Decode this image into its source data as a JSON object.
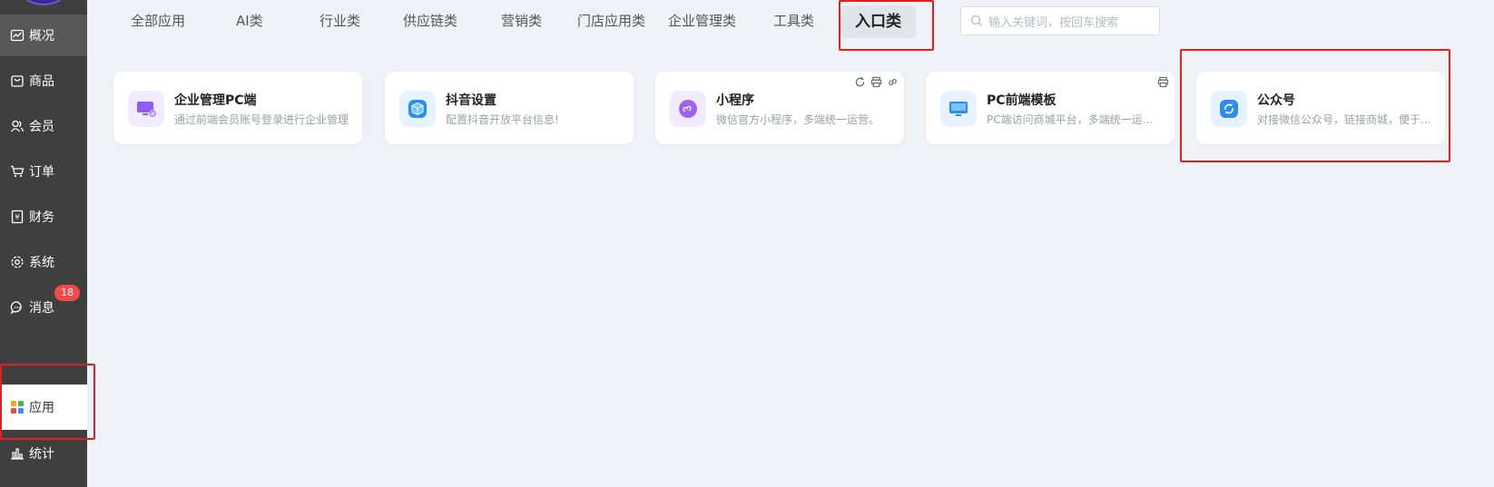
{
  "sidebar": {
    "items": [
      {
        "label": "概况",
        "icon": "chart-line-icon"
      },
      {
        "label": "商品",
        "icon": "shop-icon"
      },
      {
        "label": "会员",
        "icon": "users-icon"
      },
      {
        "label": "订单",
        "icon": "cart-icon"
      },
      {
        "label": "财务",
        "icon": "ledger-icon"
      },
      {
        "label": "系统",
        "icon": "gear-icon"
      },
      {
        "label": "消息",
        "icon": "chat-icon"
      },
      {
        "label": "应用",
        "icon": "apps-grid-icon"
      },
      {
        "label": "统计",
        "icon": "bar-chart-icon"
      }
    ],
    "message_badge": "18"
  },
  "tabs": [
    "全部应用",
    "AI类",
    "行业类",
    "供应链类",
    "营销类",
    "门店应用类",
    "企业管理类",
    "工具类",
    "入口类"
  ],
  "active_tab": "入口类",
  "search": {
    "placeholder": "输入关键词，按回车搜索"
  },
  "cards": [
    {
      "title": "企业管理PC端",
      "desc": "通过前端会员账号登录进行企业管理",
      "icon": "monitor-icon"
    },
    {
      "title": "抖音设置",
      "desc": "配置抖音开放平台信息!",
      "icon": "cube-icon"
    },
    {
      "title": "小程序",
      "desc": "微信官方小程序，多端统一运营。",
      "icon": "mini-program-icon"
    },
    {
      "title": "PC前端模板",
      "desc": "PC端访问商城平台，多端统一运...",
      "icon": "desktop-icon"
    },
    {
      "title": "公众号",
      "desc": "对接微信公众号，链接商城，便于...",
      "icon": "wechat-official-icon"
    }
  ],
  "colors": {
    "sidebar_bg": "#3f3f3f",
    "highlight": "#e0201e",
    "badge": "#f04a4a",
    "page_bg": "#eef1f5"
  }
}
